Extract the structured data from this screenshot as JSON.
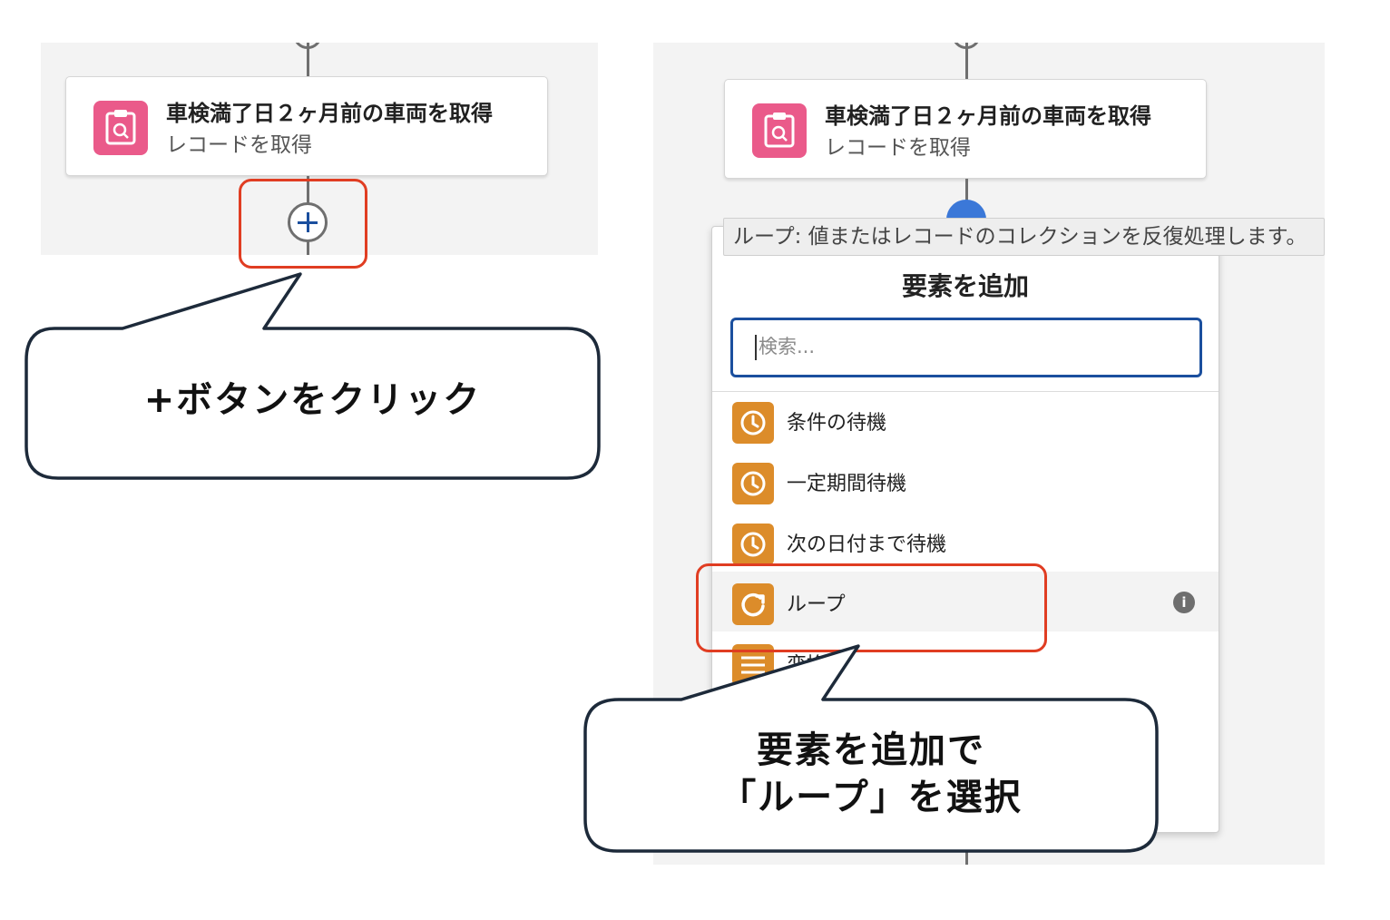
{
  "left": {
    "card": {
      "title": "車検満了日２ヶ月前の車両を取得",
      "subtitle": "レコードを取得",
      "icon": "clipboard-search-icon"
    },
    "callout": "+ボタンをクリック"
  },
  "right": {
    "card": {
      "title": "車検満了日２ヶ月前の車両を取得",
      "subtitle": "レコードを取得",
      "icon": "clipboard-search-icon"
    },
    "tooltip": "ループ: 値またはレコードのコレクションを反復処理します。",
    "panel": {
      "title": "要素を追加",
      "search_placeholder": "検索...",
      "items": [
        {
          "label": "条件の待機",
          "icon": "clock-icon"
        },
        {
          "label": "一定期間待機",
          "icon": "clock-icon"
        },
        {
          "label": "次の日付まで待機",
          "icon": "clock-icon"
        },
        {
          "label": "ループ",
          "icon": "loop-icon"
        },
        {
          "label": "変換",
          "icon": "transform-icon"
        }
      ]
    },
    "callout_line1": "要素を追加で",
    "callout_line2": "「ループ」を選択"
  },
  "colors": {
    "card_icon": "#ea5a8a",
    "item_icon": "#dc8c2a",
    "highlight": "#e03d22",
    "focus_blue": "#1b4f9e"
  }
}
